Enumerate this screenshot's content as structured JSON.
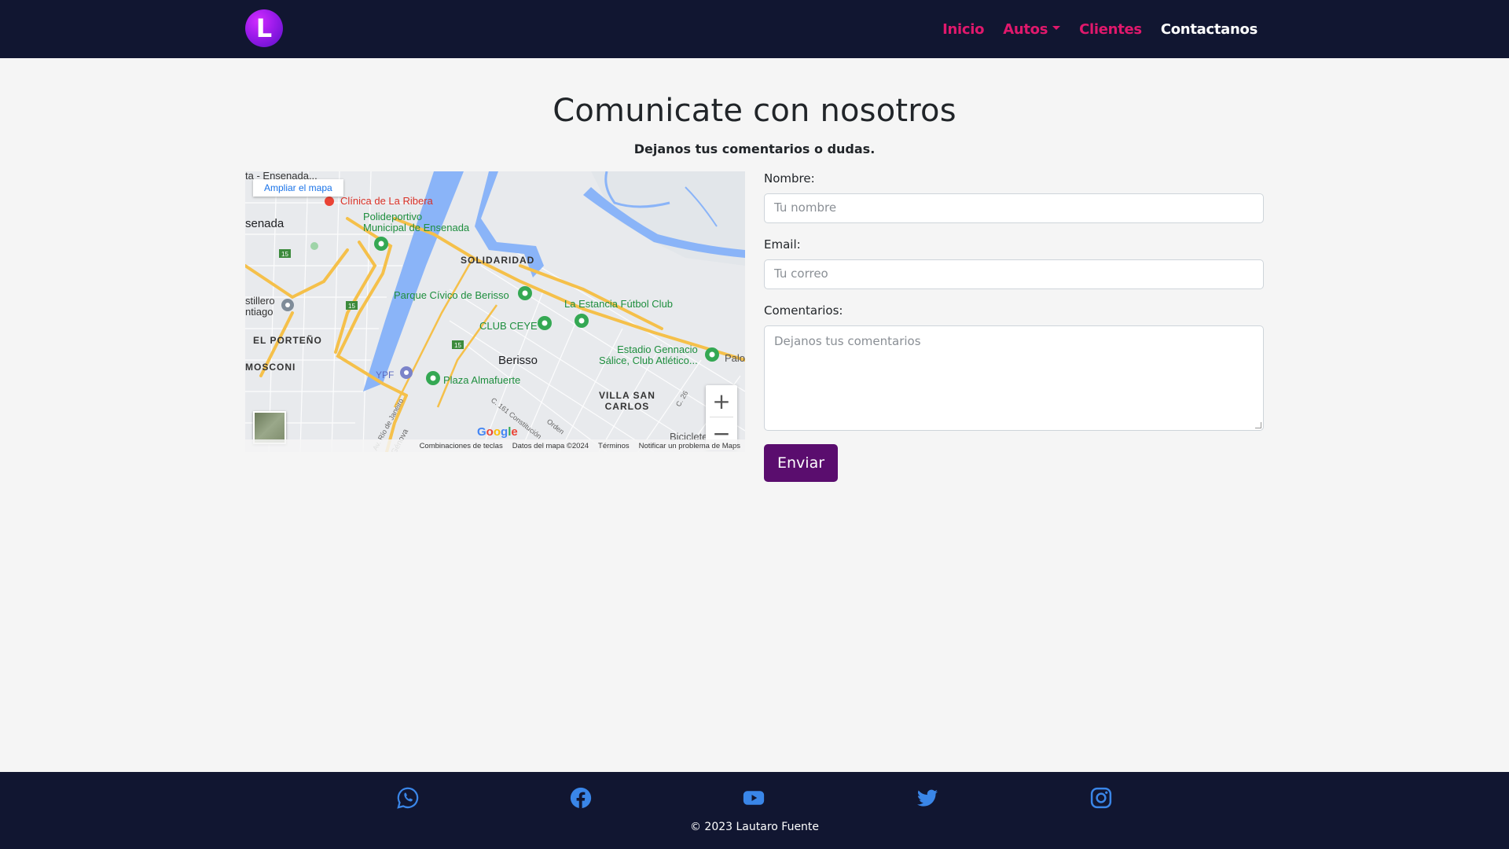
{
  "nav": {
    "logo_letter": "L",
    "items": [
      {
        "label": "Inicio"
      },
      {
        "label": "Autos"
      },
      {
        "label": "Clientes"
      },
      {
        "label": "Contactanos"
      }
    ]
  },
  "header": {
    "title": "Comunicate con nosotros",
    "subtitle": "Dejanos tus comentarios o dudas."
  },
  "map": {
    "open_label": "Ampliar el mapa",
    "labels": {
      "top_left": "ta - Ensenada...",
      "clinica": "Clínica de La Ribera",
      "polideportivo": "Polideportivo\nMunicipal de Ensenada",
      "ensenada": "senada",
      "solidaridad": "SOLIDARIDAD",
      "parque": "Parque Cívico de Berisso",
      "estancia": "La Estancia Fútbol Club",
      "astillero": "stillero\nntiago",
      "ceye": "CLUB CEYE",
      "porteno": "EL PORTEÑO",
      "estadio": "Estadio Gennacio\nSálice, Club Atlético...",
      "palo": "Palo",
      "mosconi": "MOSCONI",
      "ypf": "YPF",
      "berisso": "Berisso",
      "almafuerte": "Plaza Almafuerte",
      "villa": "VILLA SAN\nCARLOS",
      "bicicleteria": "Bicicletería",
      "constitucion": "C. 161 Constitución",
      "orden": "Orden",
      "rio": "Av. Río de Janeiro",
      "genova": "Génova",
      "c26": "C. 26"
    },
    "google": "Google",
    "footer": [
      "Combinaciones de teclas",
      "Datos del mapa ©2024",
      "Términos",
      "Notificar un problema de Maps"
    ],
    "zoom_in": "+",
    "zoom_out": "−"
  },
  "form": {
    "name_label": "Nombre:",
    "name_placeholder": "Tu nombre",
    "email_label": "Email:",
    "email_placeholder": "Tu correo",
    "comments_label": "Comentarios:",
    "comments_placeholder": "Dejanos tus comentarios",
    "submit_label": "Enviar"
  },
  "footer": {
    "social": [
      "whatsapp-icon",
      "facebook-icon",
      "youtube-icon",
      "twitter-icon",
      "instagram-icon"
    ],
    "copyright": "© 2023 Lautaro Fuente"
  },
  "colors": {
    "navbar": "#111631",
    "nav_link": "#e0186c",
    "nav_active": "#ffffff",
    "button": "#5a0d6e",
    "social_icon": "#3a86e8"
  }
}
